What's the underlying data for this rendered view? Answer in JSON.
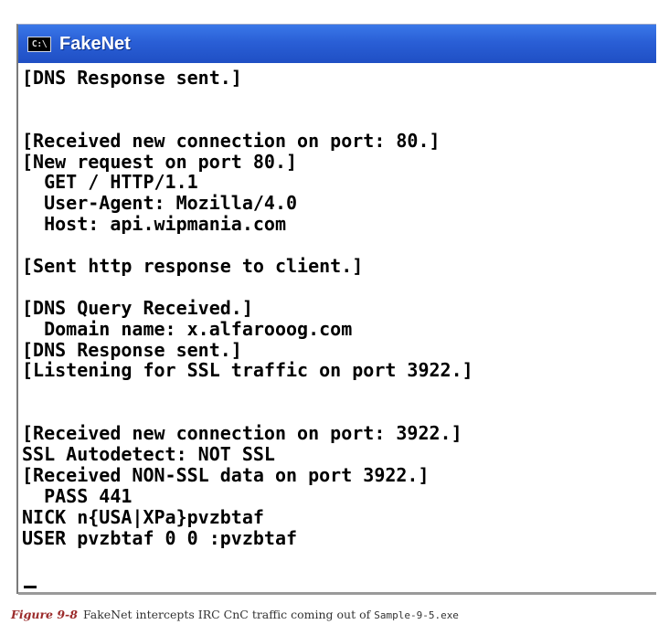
{
  "window": {
    "title": "FakeNet",
    "icon": "cmd-console-icon",
    "icon_text": "C:\\"
  },
  "console": {
    "lines": [
      "[DNS Response sent.]",
      "",
      "",
      "[Received new connection on port: 80.]",
      "[New request on port 80.]",
      "  GET / HTTP/1.1",
      "  User-Agent: Mozilla/4.0",
      "  Host: api.wipmania.com",
      "",
      "[Sent http response to client.]",
      "",
      "[DNS Query Received.]",
      "  Domain name: x.alfarooog.com",
      "[DNS Response sent.]",
      "[Listening for SSL traffic on port 3922.]",
      "",
      "",
      "[Received new connection on port: 3922.]",
      "SSL Autodetect: NOT SSL",
      "[Received NON-SSL data on port 3922.]",
      "  PASS 441",
      "NICK n{USA|XPa}pvzbtaf",
      "USER pvzbtaf 0 0 :pvzbtaf"
    ],
    "cursor": "_"
  },
  "caption": {
    "label": "Figure 9-8",
    "text": "FakeNet intercepts IRC CnC traffic coming out of ",
    "filename": "Sample-9-5.exe"
  },
  "colors": {
    "titlebar": "#2a5fd6",
    "console_bg": "#ffffff",
    "console_text": "#000000",
    "caption_label": "#9b2a2a"
  }
}
